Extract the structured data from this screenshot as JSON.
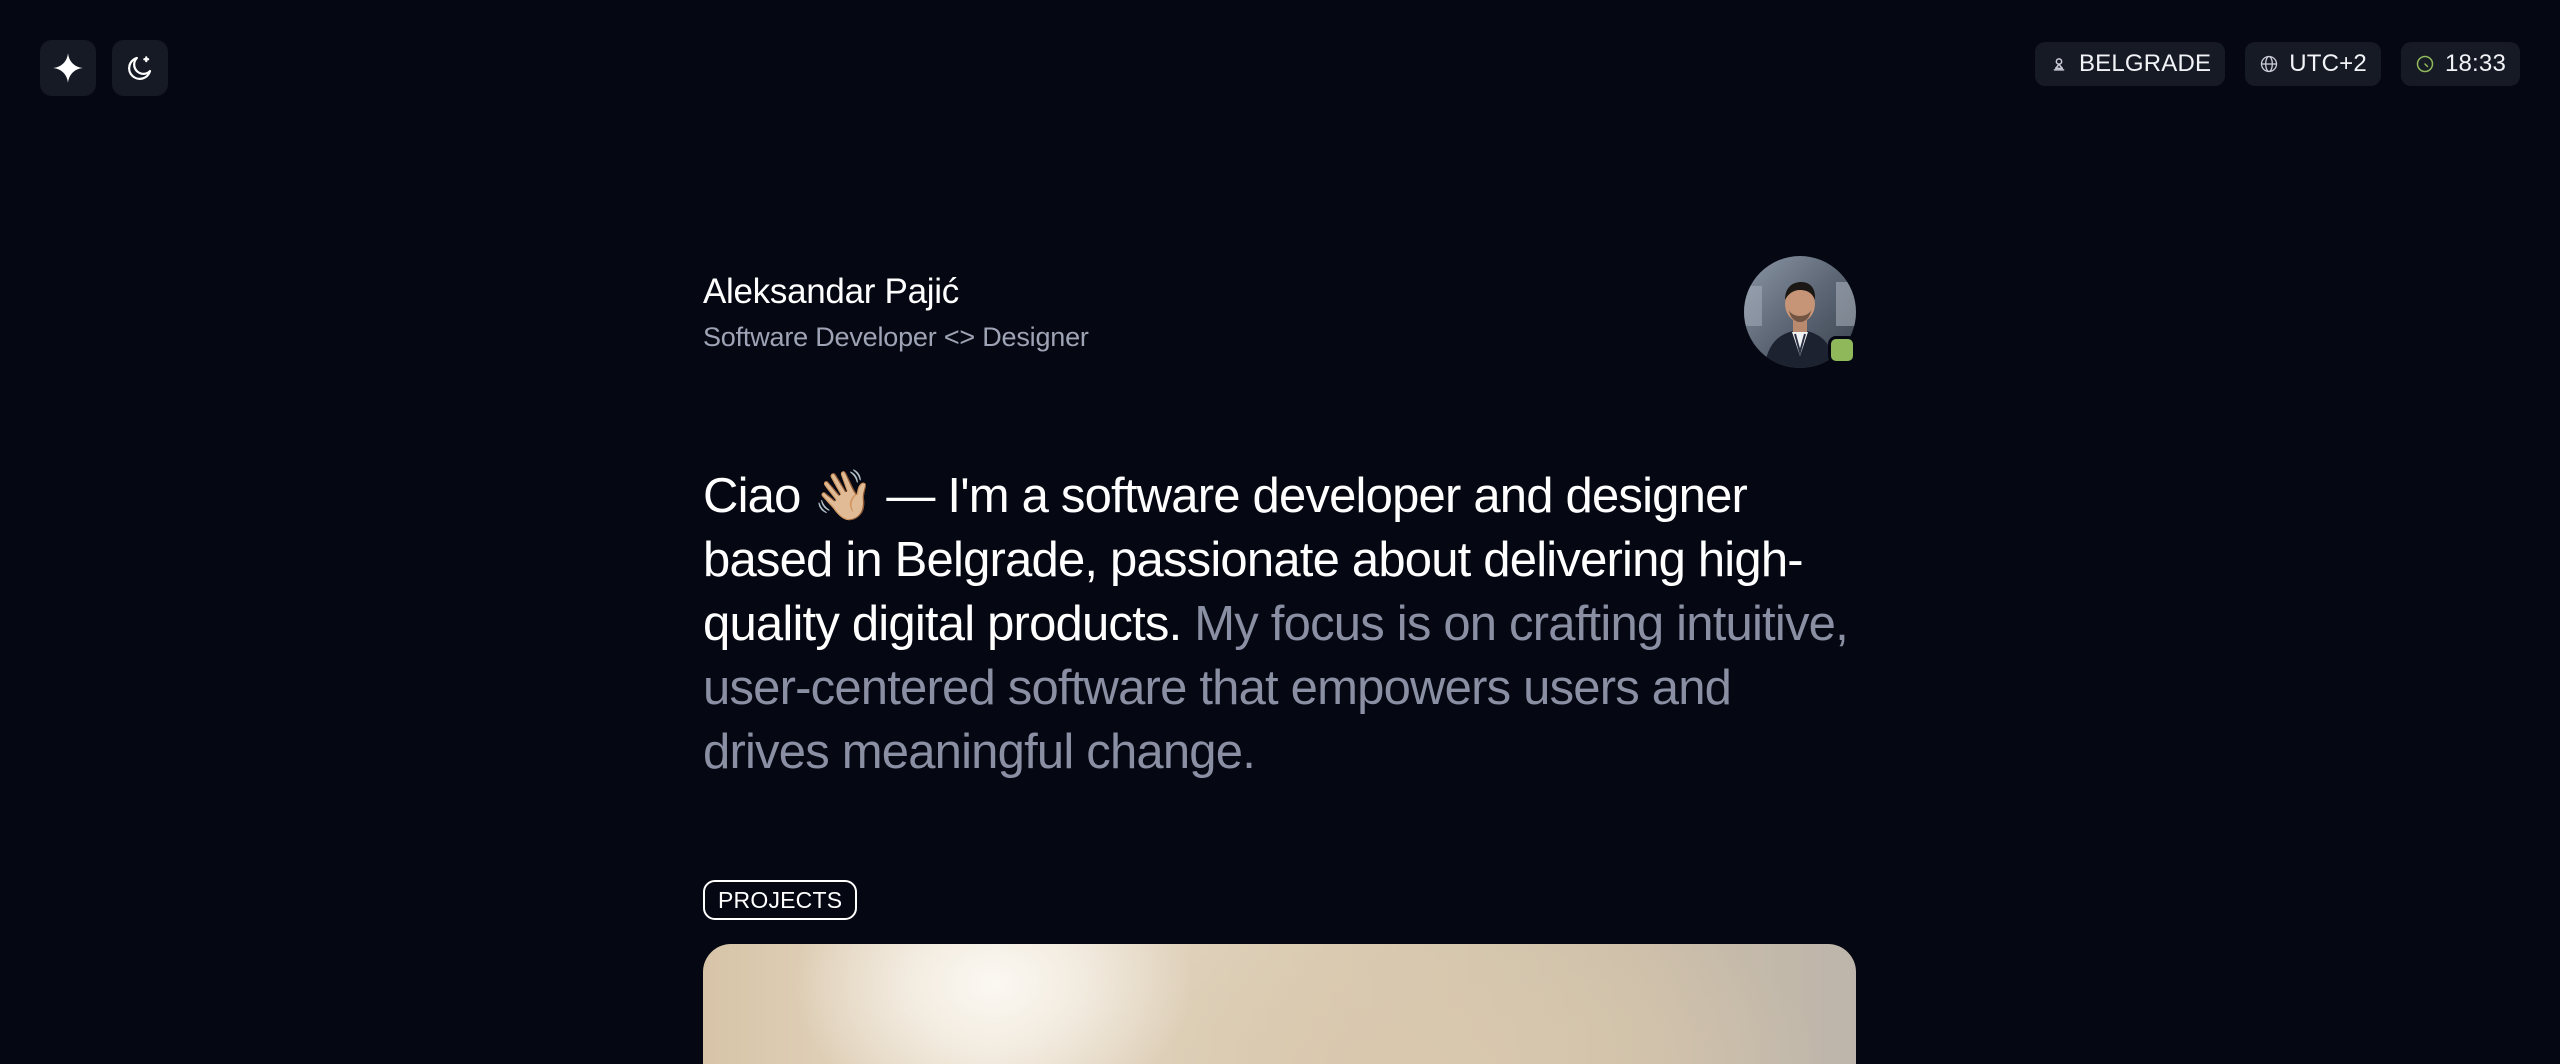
{
  "header": {
    "sparkle_button": "sparkle-icon",
    "theme_button": "moon-star-icon",
    "location": {
      "icon": "location-pin-icon",
      "label": "BELGRADE"
    },
    "timezone": {
      "icon": "globe-icon",
      "label": "UTC+2"
    },
    "clock": {
      "icon": "clock-icon",
      "label": "18:33",
      "icon_color": "#8fb85b"
    }
  },
  "profile": {
    "name": "Aleksandar Pajić",
    "role": "Software Developer <> Designer",
    "status_color": "#8fb85b"
  },
  "intro": {
    "strong_text": "Ciao 👋🏼 — I'm a software developer and designer based in Belgrade, passionate about delivering high-quality digital products.",
    "muted_text": "My focus is on crafting intuitive, user-centered software that empowers users and drives meaningful change."
  },
  "sections": {
    "projects_label": "PROJECTS"
  },
  "colors": {
    "background": "#050812",
    "chip_bg": "#161a24",
    "muted_text": "#8a8fa3"
  }
}
